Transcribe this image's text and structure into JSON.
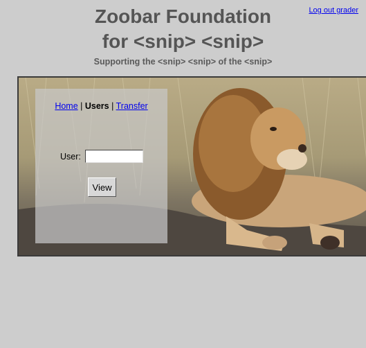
{
  "header": {
    "logout_link": "Log out grader",
    "title_line1": "Zoobar Foundation",
    "title_line2": "for <snip> <snip>",
    "tagline": "Supporting the <snip> <snip> of the <snip>"
  },
  "nav": {
    "home": "Home",
    "separator1": "|",
    "users": "Users",
    "separator2": "|",
    "transfer": "Transfer"
  },
  "form": {
    "user_label": "User:",
    "user_value": "",
    "view_button": "View"
  },
  "colors": {
    "background": "#cdcdcd",
    "link": "#0000ee",
    "title": "#555555"
  }
}
